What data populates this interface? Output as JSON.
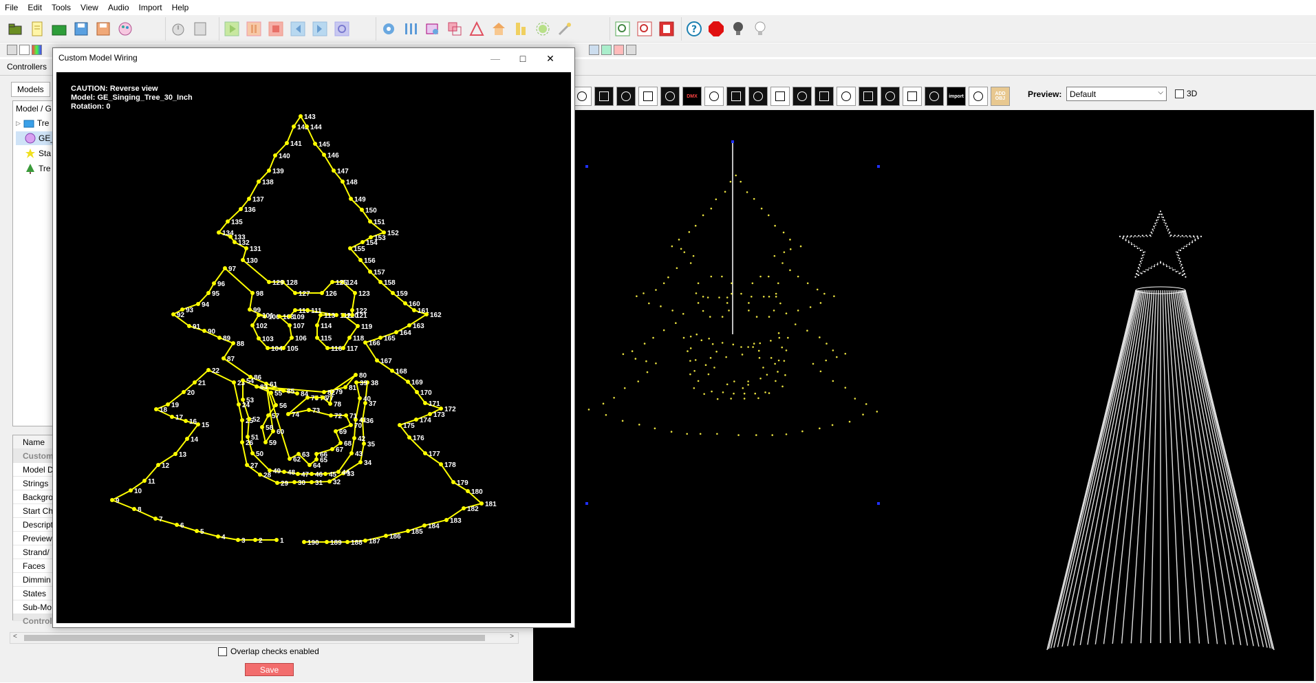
{
  "menu": [
    "File",
    "Edit",
    "Tools",
    "View",
    "Audio",
    "Import",
    "Help"
  ],
  "tabs": {
    "controllers": "Controllers"
  },
  "left_panel": {
    "models_tab": "Models",
    "tree_header": "Model / G",
    "tree_items": [
      "Tre",
      "GE_",
      "Sta",
      "Tre"
    ],
    "props_header": "Name",
    "props": [
      "Custom",
      "Model D",
      "Strings",
      "Backgro",
      "Start Ch",
      "Descript",
      "Preview",
      "Strand/",
      "Faces",
      "Dimmin",
      "States",
      "Sub-Mo",
      "Control"
    ],
    "overlap_label": "Overlap checks enabled",
    "save_label": "Save"
  },
  "preview": {
    "label": "Preview:",
    "selected": "Default",
    "threed_label": "3D",
    "tools": [
      "",
      "",
      "",
      "",
      "",
      "DMX",
      "",
      "",
      "",
      "",
      "",
      "",
      "",
      "",
      "",
      "",
      "",
      "import",
      "",
      "ADD OBJ"
    ]
  },
  "dialog": {
    "title": "Custom Model Wiring",
    "caution": "CAUTION: Reverse view",
    "model": "Model: GE_Singing_Tree_30_Inch",
    "rotation": "Rotation: 0",
    "nodes": [
      [
        1,
        401,
        784
      ],
      [
        2,
        370,
        784
      ],
      [
        3,
        345,
        784
      ],
      [
        4,
        316,
        779
      ],
      [
        5,
        285,
        771
      ],
      [
        6,
        256,
        762
      ],
      [
        7,
        225,
        753
      ],
      [
        8,
        194,
        739
      ],
      [
        9,
        162,
        726
      ],
      [
        10,
        189,
        712
      ],
      [
        11,
        209,
        698
      ],
      [
        12,
        229,
        675
      ],
      [
        13,
        254,
        659
      ],
      [
        14,
        271,
        637
      ],
      [
        15,
        287,
        616
      ],
      [
        16,
        269,
        611
      ],
      [
        17,
        249,
        605
      ],
      [
        18,
        226,
        594
      ],
      [
        19,
        243,
        587
      ],
      [
        20,
        266,
        569
      ],
      [
        21,
        282,
        555
      ],
      [
        22,
        302,
        537
      ],
      [
        23,
        339,
        555
      ],
      [
        24,
        346,
        587
      ],
      [
        25,
        351,
        610
      ],
      [
        26,
        351,
        642
      ],
      [
        27,
        358,
        675
      ],
      [
        28,
        377,
        689
      ],
      [
        29,
        402,
        701
      ],
      [
        30,
        427,
        700
      ],
      [
        31,
        452,
        700
      ],
      [
        32,
        478,
        699
      ],
      [
        33,
        498,
        687
      ],
      [
        34,
        523,
        671
      ],
      [
        35,
        528,
        644
      ],
      [
        36,
        526,
        610
      ],
      [
        37,
        530,
        585
      ],
      [
        38,
        533,
        555
      ],
      [
        39,
        517,
        555
      ],
      [
        40,
        522,
        578
      ],
      [
        41,
        516,
        609
      ],
      [
        42,
        514,
        636
      ],
      [
        43,
        510,
        658
      ],
      [
        44,
        491,
        685
      ],
      [
        45,
        472,
        688
      ],
      [
        46,
        452,
        688
      ],
      [
        47,
        432,
        688
      ],
      [
        48,
        412,
        685
      ],
      [
        49,
        391,
        683
      ],
      [
        50,
        366,
        658
      ],
      [
        51,
        359,
        634
      ],
      [
        52,
        361,
        608
      ],
      [
        53,
        352,
        580
      ],
      [
        54,
        352,
        552
      ],
      [
        55,
        393,
        570
      ],
      [
        56,
        400,
        588
      ],
      [
        57,
        389,
        603
      ],
      [
        58,
        380,
        620
      ],
      [
        59,
        385,
        642
      ],
      [
        60,
        396,
        626
      ],
      [
        61,
        386,
        557
      ],
      [
        62,
        420,
        666
      ],
      [
        63,
        433,
        659
      ],
      [
        64,
        449,
        675
      ],
      [
        65,
        459,
        667
      ],
      [
        66,
        459,
        659
      ],
      [
        67,
        482,
        652
      ],
      [
        68,
        494,
        643
      ],
      [
        69,
        487,
        626
      ],
      [
        70,
        509,
        617
      ],
      [
        71,
        502,
        603
      ],
      [
        72,
        480,
        603
      ],
      [
        73,
        448,
        595
      ],
      [
        74,
        418,
        601
      ],
      [
        75,
        446,
        577
      ],
      [
        76,
        459,
        577
      ],
      [
        77,
        468,
        577
      ],
      [
        78,
        479,
        586
      ],
      [
        79,
        481,
        568
      ],
      [
        80,
        516,
        544
      ],
      [
        81,
        501,
        562
      ],
      [
        82,
        470,
        569
      ],
      [
        83,
        372,
        561
      ],
      [
        84,
        431,
        571
      ],
      [
        85,
        411,
        567
      ],
      [
        86,
        363,
        547
      ],
      [
        87,
        324,
        520
      ],
      [
        88,
        338,
        498
      ],
      [
        89,
        318,
        490
      ],
      [
        90,
        296,
        480
      ],
      [
        91,
        274,
        473
      ],
      [
        92,
        251,
        456
      ],
      [
        93,
        264,
        449
      ],
      [
        94,
        287,
        441
      ],
      [
        95,
        302,
        425
      ],
      [
        96,
        310,
        411
      ],
      [
        97,
        326,
        389
      ],
      [
        98,
        366,
        425
      ],
      [
        99,
        362,
        449
      ],
      [
        100,
        384,
        459
      ],
      [
        101,
        375,
        457
      ],
      [
        102,
        366,
        472
      ],
      [
        103,
        375,
        491
      ],
      [
        104,
        388,
        505
      ],
      [
        105,
        411,
        505
      ],
      [
        106,
        423,
        490
      ],
      [
        107,
        420,
        472
      ],
      [
        108,
        405,
        459
      ],
      [
        109,
        420,
        459
      ],
      [
        110,
        428,
        450
      ],
      [
        111,
        446,
        450
      ],
      [
        112,
        488,
        457
      ],
      [
        113,
        465,
        457
      ],
      [
        114,
        460,
        472
      ],
      [
        115,
        460,
        490
      ],
      [
        116,
        475,
        505
      ],
      [
        117,
        498,
        505
      ],
      [
        118,
        507,
        490
      ],
      [
        119,
        519,
        473
      ],
      [
        120,
        498,
        457
      ],
      [
        121,
        511,
        457
      ],
      [
        122,
        511,
        450
      ],
      [
        123,
        515,
        425
      ],
      [
        124,
        497,
        409
      ],
      [
        125,
        482,
        409
      ],
      [
        126,
        467,
        425
      ],
      [
        127,
        428,
        425
      ],
      [
        128,
        410,
        409
      ],
      [
        129,
        390,
        409
      ],
      [
        130,
        352,
        377
      ],
      [
        131,
        357,
        360
      ],
      [
        132,
        340,
        351
      ],
      [
        133,
        334,
        343
      ],
      [
        134,
        317,
        337
      ],
      [
        135,
        330,
        321
      ],
      [
        136,
        349,
        303
      ],
      [
        137,
        361,
        288
      ],
      [
        138,
        375,
        263
      ],
      [
        139,
        390,
        247
      ],
      [
        140,
        399,
        225
      ],
      [
        141,
        416,
        207
      ],
      [
        142,
        426,
        183
      ],
      [
        143,
        436,
        168
      ],
      [
        144,
        445,
        183
      ],
      [
        145,
        457,
        208
      ],
      [
        146,
        470,
        224
      ],
      [
        147,
        484,
        247
      ],
      [
        148,
        497,
        263
      ],
      [
        149,
        509,
        288
      ],
      [
        150,
        525,
        304
      ],
      [
        151,
        537,
        321
      ],
      [
        152,
        557,
        337
      ],
      [
        153,
        538,
        344
      ],
      [
        154,
        526,
        351
      ],
      [
        155,
        508,
        360
      ],
      [
        156,
        523,
        377
      ],
      [
        157,
        537,
        394
      ],
      [
        158,
        552,
        409
      ],
      [
        159,
        570,
        425
      ],
      [
        160,
        588,
        440
      ],
      [
        161,
        601,
        450
      ],
      [
        162,
        619,
        456
      ],
      [
        163,
        594,
        472
      ],
      [
        164,
        575,
        482
      ],
      [
        165,
        552,
        490
      ],
      [
        166,
        530,
        497
      ],
      [
        167,
        547,
        523
      ],
      [
        168,
        569,
        538
      ],
      [
        169,
        592,
        554
      ],
      [
        170,
        605,
        569
      ],
      [
        171,
        617,
        585
      ],
      [
        172,
        640,
        593
      ],
      [
        173,
        624,
        601
      ],
      [
        174,
        604,
        609
      ],
      [
        175,
        580,
        617
      ],
      [
        176,
        594,
        635
      ],
      [
        177,
        617,
        658
      ],
      [
        178,
        640,
        674
      ],
      [
        179,
        658,
        700
      ],
      [
        180,
        679,
        713
      ],
      [
        181,
        699,
        731
      ],
      [
        182,
        673,
        738
      ],
      [
        183,
        648,
        755
      ],
      [
        184,
        616,
        763
      ],
      [
        185,
        592,
        771
      ],
      [
        186,
        560,
        778
      ],
      [
        187,
        530,
        785
      ],
      [
        188,
        504,
        787
      ],
      [
        189,
        474,
        787
      ],
      [
        190,
        441,
        787
      ]
    ]
  }
}
